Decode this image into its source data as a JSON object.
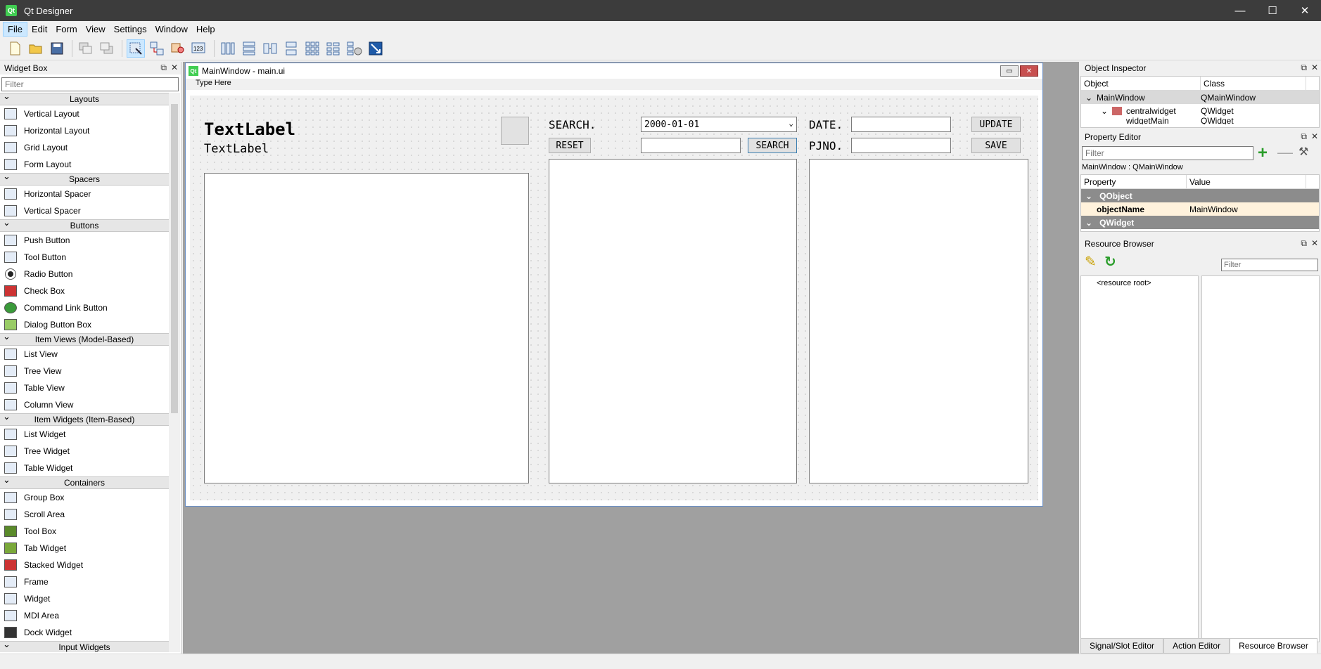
{
  "window": {
    "title": "Qt Designer",
    "app_icon": "Qt"
  },
  "menu": [
    "File",
    "Edit",
    "Form",
    "View",
    "Settings",
    "Window",
    "Help"
  ],
  "widget_box": {
    "title": "Widget Box",
    "filter_placeholder": "Filter",
    "categories": [
      {
        "name": "Layouts",
        "items": [
          "Vertical Layout",
          "Horizontal Layout",
          "Grid Layout",
          "Form Layout"
        ]
      },
      {
        "name": "Spacers",
        "items": [
          "Horizontal Spacer",
          "Vertical Spacer"
        ]
      },
      {
        "name": "Buttons",
        "items": [
          "Push Button",
          "Tool Button",
          "Radio Button",
          "Check Box",
          "Command Link Button",
          "Dialog Button Box"
        ]
      },
      {
        "name": "Item Views (Model-Based)",
        "items": [
          "List View",
          "Tree View",
          "Table View",
          "Column View"
        ]
      },
      {
        "name": "Item Widgets (Item-Based)",
        "items": [
          "List Widget",
          "Tree Widget",
          "Table Widget"
        ]
      },
      {
        "name": "Containers",
        "items": [
          "Group Box",
          "Scroll Area",
          "Tool Box",
          "Tab Widget",
          "Stacked Widget",
          "Frame",
          "Widget",
          "MDI Area",
          "Dock Widget"
        ]
      },
      {
        "name": "Input Widgets",
        "items": []
      }
    ]
  },
  "form": {
    "title": "MainWindow - main.ui",
    "qt_badge": "Qt",
    "type_here": "Type Here",
    "label_big": "TextLabel",
    "label_small": "TextLabel",
    "search_label": "SEARCH.",
    "date_combo_value": "2000-01-01",
    "reset_button": "RESET",
    "search_button": "SEARCH",
    "search_input_value": "",
    "date_label": "DATE.",
    "pjno_label": "PJNO.",
    "update_button": "UPDATE",
    "save_button": "SAVE"
  },
  "object_inspector": {
    "title": "Object Inspector",
    "columns": [
      "Object",
      "Class"
    ],
    "rows": [
      {
        "object": "MainWindow",
        "class": "QMainWindow"
      },
      {
        "object": "centralwidget",
        "class": "QWidget"
      },
      {
        "object": "widgetMain",
        "class": "QWidget"
      }
    ]
  },
  "property_editor": {
    "title": "Property Editor",
    "filter_placeholder": "Filter",
    "context": "MainWindow : QMainWindow",
    "columns": [
      "Property",
      "Value"
    ],
    "group1": "QObject",
    "prop_name": "objectName",
    "prop_value": "MainWindow",
    "group2": "QWidget"
  },
  "resource_browser": {
    "title": "Resource Browser",
    "filter_placeholder": "Filter",
    "root": "<resource root>"
  },
  "bottom_tabs": [
    "Signal/Slot Editor",
    "Action Editor",
    "Resource Browser"
  ]
}
